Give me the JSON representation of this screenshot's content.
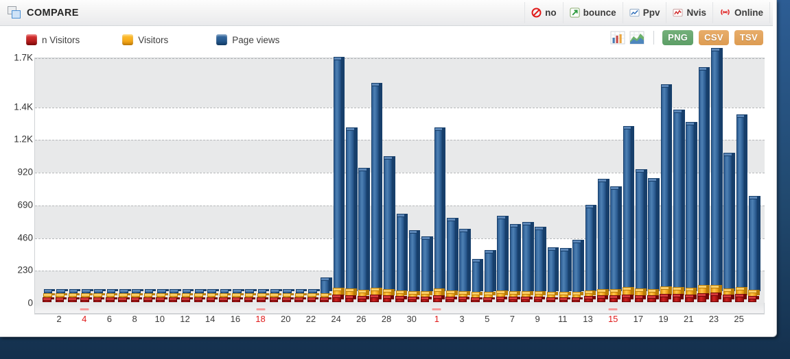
{
  "window": {
    "title": "COMPARE",
    "compare_icon": "overlapping-squares-icon"
  },
  "toolbar": {
    "buttons": [
      {
        "label": "no",
        "icon": "no-entry-icon"
      },
      {
        "label": "bounce",
        "icon": "green-arrow-out-icon"
      },
      {
        "label": "Ppv",
        "icon": "blue-line-chart-icon"
      },
      {
        "label": "Nvis",
        "icon": "red-line-chart-icon"
      },
      {
        "label": "Online",
        "icon": "broadcast-antenna-icon"
      }
    ]
  },
  "legend": {
    "items": [
      {
        "label": "n Visitors",
        "color": "#c01b1b",
        "key": "unique_visitors"
      },
      {
        "label": "Visitors",
        "color": "#f5a81c",
        "key": "visitors"
      },
      {
        "label": "Page views",
        "color": "#2c5c92",
        "key": "page_views"
      }
    ],
    "chart_type_toggles": [
      {
        "name": "bar-chart-toggle-icon",
        "selected": false
      },
      {
        "name": "area-chart-toggle-icon",
        "selected": true
      }
    ],
    "export_buttons": [
      {
        "label": "PNG",
        "color": "#5c9e66"
      },
      {
        "label": "CSV",
        "color": "#dd9c52"
      },
      {
        "label": "TSV",
        "color": "#dd9c52"
      }
    ]
  },
  "chart_data": {
    "type": "bar",
    "title": "COMPARE",
    "xlabel": "",
    "ylabel": "",
    "ylim": [
      0,
      1725
    ],
    "grid": true,
    "legend_position": "top-left",
    "y_ticks": [
      0,
      230,
      460,
      690,
      920,
      1150,
      1380,
      1725
    ],
    "y_tick_labels": [
      "0",
      "230",
      "460",
      "690",
      "920",
      "1.2K",
      "1.4K",
      "1.7K"
    ],
    "categories": [
      "1",
      "2",
      "3",
      "4",
      "5",
      "6",
      "7",
      "8",
      "9",
      "10",
      "11",
      "12",
      "13",
      "14",
      "15",
      "16",
      "17",
      "18",
      "19",
      "20",
      "21",
      "22",
      "23",
      "24",
      "25",
      "26",
      "27",
      "28",
      "29",
      "30",
      "31",
      "1",
      "2",
      "3",
      "4",
      "5",
      "6",
      "7",
      "8",
      "9",
      "10",
      "11",
      "12",
      "13",
      "14",
      "15",
      "16",
      "17",
      "18",
      "19",
      "20",
      "21",
      "22",
      "23",
      "24",
      "25",
      "26"
    ],
    "x_tick_labels": [
      {
        "index": 1,
        "label": "2",
        "weekend": false
      },
      {
        "index": 3,
        "label": "4",
        "weekend": true
      },
      {
        "index": 5,
        "label": "6",
        "weekend": false
      },
      {
        "index": 7,
        "label": "8",
        "weekend": false
      },
      {
        "index": 9,
        "label": "10",
        "weekend": false
      },
      {
        "index": 11,
        "label": "12",
        "weekend": false
      },
      {
        "index": 13,
        "label": "14",
        "weekend": false
      },
      {
        "index": 15,
        "label": "16",
        "weekend": false
      },
      {
        "index": 17,
        "label": "18",
        "weekend": true
      },
      {
        "index": 19,
        "label": "20",
        "weekend": false
      },
      {
        "index": 21,
        "label": "22",
        "weekend": false
      },
      {
        "index": 23,
        "label": "24",
        "weekend": false
      },
      {
        "index": 25,
        "label": "26",
        "weekend": false
      },
      {
        "index": 27,
        "label": "28",
        "weekend": false
      },
      {
        "index": 29,
        "label": "30",
        "weekend": false
      },
      {
        "index": 31,
        "label": "1",
        "weekend": true
      },
      {
        "index": 33,
        "label": "3",
        "weekend": false
      },
      {
        "index": 35,
        "label": "5",
        "weekend": false
      },
      {
        "index": 37,
        "label": "7",
        "weekend": false
      },
      {
        "index": 39,
        "label": "9",
        "weekend": false
      },
      {
        "index": 41,
        "label": "11",
        "weekend": false
      },
      {
        "index": 43,
        "label": "13",
        "weekend": false
      },
      {
        "index": 45,
        "label": "15",
        "weekend": true
      },
      {
        "index": 47,
        "label": "17",
        "weekend": false
      },
      {
        "index": 49,
        "label": "19",
        "weekend": false
      },
      {
        "index": 51,
        "label": "21",
        "weekend": false
      },
      {
        "index": 53,
        "label": "23",
        "weekend": false
      },
      {
        "index": 55,
        "label": "25",
        "weekend": false
      }
    ],
    "series": [
      {
        "name": "Page views",
        "color": "#2c5c92",
        "values": [
          0,
          0,
          0,
          0,
          0,
          0,
          0,
          0,
          0,
          0,
          0,
          0,
          0,
          0,
          0,
          0,
          0,
          0,
          0,
          0,
          0,
          0,
          95,
          1650,
          1150,
          865,
          1465,
          950,
          545,
          430,
          385,
          1150,
          515,
          440,
          225,
          290,
          530,
          470,
          485,
          455,
          310,
          305,
          360,
          605,
          790,
          735,
          1160,
          860,
          795,
          1455,
          1275,
          1190,
          1575,
          1710,
          975,
          1245,
          670
        ]
      },
      {
        "name": "Visitors",
        "color": "#f5a81c",
        "values": [
          8,
          8,
          8,
          8,
          8,
          8,
          8,
          8,
          8,
          8,
          8,
          8,
          8,
          8,
          8,
          8,
          8,
          8,
          8,
          8,
          8,
          8,
          14,
          52,
          46,
          40,
          55,
          44,
          34,
          30,
          28,
          48,
          32,
          30,
          22,
          24,
          32,
          30,
          30,
          28,
          22,
          22,
          24,
          36,
          44,
          42,
          56,
          46,
          44,
          62,
          58,
          55,
          70,
          72,
          50,
          58,
          38
        ]
      },
      {
        "name": "n Visitors",
        "color": "#c01b1b",
        "values": [
          5,
          5,
          5,
          5,
          5,
          5,
          5,
          5,
          5,
          5,
          5,
          5,
          5,
          5,
          5,
          5,
          5,
          5,
          5,
          5,
          5,
          5,
          9,
          34,
          30,
          26,
          36,
          29,
          22,
          20,
          18,
          31,
          21,
          20,
          14,
          16,
          21,
          20,
          20,
          18,
          14,
          14,
          16,
          24,
          29,
          27,
          36,
          30,
          29,
          40,
          38,
          36,
          45,
          46,
          32,
          37,
          24
        ]
      }
    ]
  }
}
